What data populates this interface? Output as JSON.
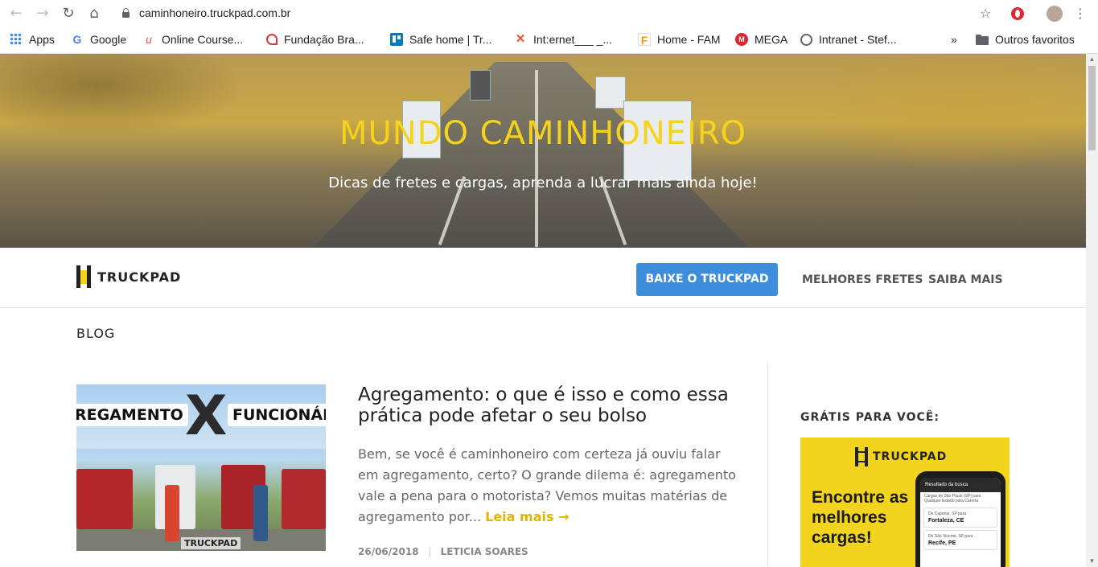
{
  "browser": {
    "url": "caminhoneiro.truckpad.com.br",
    "bookmarks": [
      {
        "label": "Apps"
      },
      {
        "label": "Google"
      },
      {
        "label": "Online Course..."
      },
      {
        "label": "Fundação Bra..."
      },
      {
        "label": "Safe home | Tr..."
      },
      {
        "label": "Int:ernet___ _..."
      },
      {
        "label": "Home - FAM"
      },
      {
        "label": "MEGA"
      },
      {
        "label": "Intranet - Stef..."
      }
    ],
    "overflow": "»",
    "other_favorites": "Outros favoritos"
  },
  "hero": {
    "title": "MUNDO CAMINHONEIRO",
    "subtitle": "Dicas de fretes e cargas, aprenda a lucrar mais ainda hoje!"
  },
  "nav": {
    "logo_text": "TRUCKPAD",
    "download_button": "BAIXE O TRUCKPAD",
    "links": [
      "MELHORES FRETES",
      "SAIBA MAIS"
    ]
  },
  "blog": {
    "label": "BLOG",
    "post": {
      "thumb_left_word": "REGAMENTO",
      "thumb_x": "X",
      "thumb_right_word": "FUNCIONÁR",
      "thumb_brand": "TRUCKPAD",
      "title": "Agregamento: o que é isso e como essa prática pode afetar o seu bolso",
      "excerpt": "Bem, se você é caminhoneiro com certeza já ouviu falar em agregamento, certo? O grande dilema é: agregamento vale a pena para o motorista? Vemos muitas matérias de agregamento por...",
      "read_more": "Leia mais →",
      "date": "26/06/2018",
      "author": "LETICIA SOARES"
    }
  },
  "sidebar": {
    "title": "GRÁTIS PARA VOCÊ:",
    "ad": {
      "logo_text": "TRUCKPAD",
      "headline": "Encontre as melhores cargas!",
      "screen_header": "Resultado da busca",
      "screen_line": "Cargas de São Paulo (SP) para Qualquer Estado para Carreta",
      "card1_from": "De Cajamar, SP para",
      "card1_city": "Fortaleza, CE",
      "card2_from": "De São Vicente, SP para",
      "card2_city": "Recife, PE"
    }
  },
  "colors": {
    "accent_yellow": "#f5d21b",
    "button_blue": "#3d8ddc",
    "read_more": "#e0b400"
  }
}
